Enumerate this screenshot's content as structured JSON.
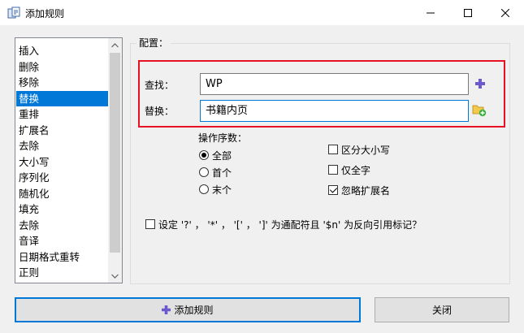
{
  "window": {
    "title": "添加规则",
    "icon": "rename-app-icon",
    "controls": {
      "minimize": "—",
      "maximize": "☐",
      "close": "✕"
    }
  },
  "rule_list": {
    "items": [
      "插入",
      "删除",
      "移除",
      "替换",
      "重排",
      "扩展名",
      "去除",
      "大小写",
      "序列化",
      "随机化",
      "填充",
      "去除",
      "音译",
      "日期格式重转",
      "正则"
    ],
    "selected_index": 3
  },
  "config": {
    "group_label": "配置：",
    "find_label": "查找：",
    "find_value": "WP",
    "replace_label": "替换：",
    "replace_value": "书籍内页",
    "ops_label": "操作序数：",
    "radio_options": [
      {
        "label": "全部",
        "checked": true
      },
      {
        "label": "首个",
        "checked": false
      },
      {
        "label": "末个",
        "checked": false
      }
    ],
    "checkbox_options": [
      {
        "label": "区分大小写",
        "checked": false
      },
      {
        "label": "仅全字",
        "checked": false
      },
      {
        "label": "忽略扩展名",
        "checked": true
      }
    ],
    "wildcard_label": "设定 '?' ， '*' ， '[' ， ']' 为通配符且 '$n' 为反向引用标记？",
    "wildcard_checked": false
  },
  "buttons": {
    "add_rule": "添加规则",
    "close": "关闭"
  },
  "colors": {
    "selection": "#0078d7",
    "highlight_border": "#e81123",
    "accent_plus": "#6a5acd"
  }
}
